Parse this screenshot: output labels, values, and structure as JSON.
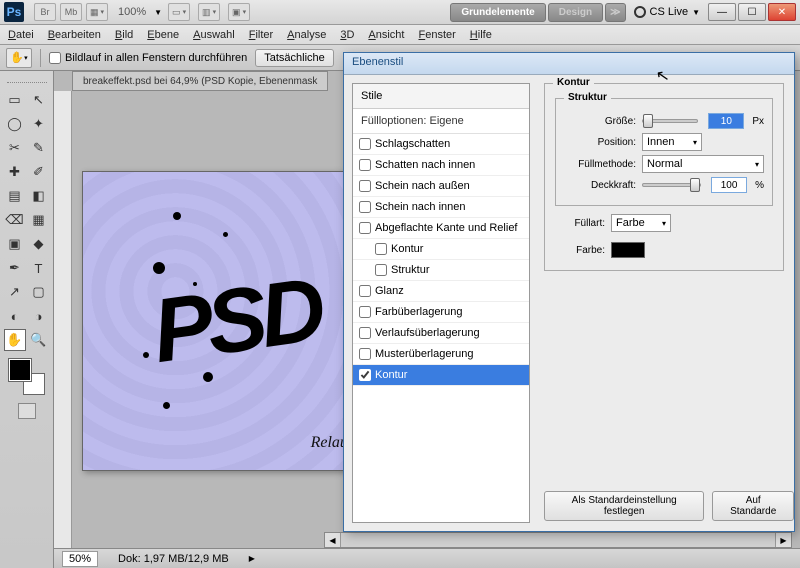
{
  "titlebar": {
    "zoom": "100%",
    "essentials": "Grundelemente",
    "design": "Design",
    "more": "≫",
    "cslive": "CS Live"
  },
  "menu": [
    "Datei",
    "Bearbeiten",
    "Bild",
    "Ebene",
    "Auswahl",
    "Filter",
    "Analyse",
    "3D",
    "Ansicht",
    "Fenster",
    "Hilfe"
  ],
  "optbar": {
    "scroll_all": "Bildlauf in allen Fenstern durchführen",
    "actual": "Tatsächliche"
  },
  "doc_tab": "breakeffekt.psd bei 64,9% (PSD Kopie, Ebenenmask",
  "canvas": {
    "relaunch": "Relaunch",
    "psd": "PSD"
  },
  "status": {
    "zoom": "50%",
    "docinfo": "Dok: 1,97 MB/12,9 MB"
  },
  "dialog": {
    "title": "Ebenenstil",
    "left": {
      "head": "Stile",
      "fillopt": "Füllloptionen: Eigene",
      "items": [
        {
          "label": "Schlagschatten",
          "checked": false,
          "sub": false
        },
        {
          "label": "Schatten nach innen",
          "checked": false,
          "sub": false
        },
        {
          "label": "Schein nach außen",
          "checked": false,
          "sub": false
        },
        {
          "label": "Schein nach innen",
          "checked": false,
          "sub": false
        },
        {
          "label": "Abgeflachte Kante und Relief",
          "checked": false,
          "sub": false
        },
        {
          "label": "Kontur",
          "checked": false,
          "sub": true
        },
        {
          "label": "Struktur",
          "checked": false,
          "sub": true
        },
        {
          "label": "Glanz",
          "checked": false,
          "sub": false
        },
        {
          "label": "Farbüberlagerung",
          "checked": false,
          "sub": false
        },
        {
          "label": "Verlaufsüberlagerung",
          "checked": false,
          "sub": false
        },
        {
          "label": "Musterüberlagerung",
          "checked": false,
          "sub": false
        },
        {
          "label": "Kontur",
          "checked": true,
          "sub": false,
          "selected": true
        }
      ]
    },
    "stroke": {
      "group": "Kontur",
      "struct": "Struktur",
      "size_l": "Größe:",
      "size_v": "10",
      "size_u": "Px",
      "pos_l": "Position:",
      "pos_v": "Innen",
      "blend_l": "Füllmethode:",
      "blend_v": "Normal",
      "opac_l": "Deckkraft:",
      "opac_v": "100",
      "opac_u": "%",
      "fill_l": "Füllart:",
      "fill_v": "Farbe",
      "color_l": "Farbe:"
    },
    "buttons": {
      "default": "Als Standardeinstellung festlegen",
      "reset": "Auf Standarde"
    }
  },
  "tools": [
    "▭",
    "↖",
    "◯",
    "✦",
    "✂",
    "✎",
    "✚",
    "✐",
    "▤",
    "◧",
    "⌫",
    "▦",
    "▣",
    "◆",
    "◐",
    "◑",
    "✒",
    "T",
    "↗",
    "▢",
    "✋",
    "🔍"
  ]
}
